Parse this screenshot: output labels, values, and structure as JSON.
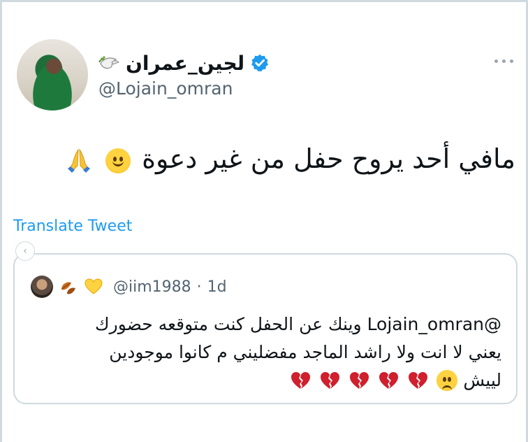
{
  "author": {
    "display_name": "لجين_عمران",
    "handle": "@Lojain_omran",
    "verified": true,
    "name_emoji": "dove-icon"
  },
  "tweet": {
    "text": "مافي أحد يروح حفل من غير دعوة",
    "emojis": [
      "smiling-face-icon",
      "folded-hands-icon"
    ],
    "translate_label": "Translate Tweet"
  },
  "quoted": {
    "handle": "@iim1988",
    "separator": "·",
    "time": "1d",
    "name_emojis": [
      "fallen-leaves-icon",
      "yellow-heart-icon"
    ],
    "line1": "@Lojain_omran وينك عن الحفل كنت متوقعه حضورك",
    "line2": "يعني لا انت ولا راشد الماجد مفضليني م كانوا موجودين",
    "line3": "لييش",
    "line3_emojis": [
      "frowning-face-icon",
      "broken-heart-icon",
      "broken-heart-icon",
      "broken-heart-icon",
      "broken-heart-icon",
      "broken-heart-icon"
    ]
  },
  "colors": {
    "link": "#1d9bf0",
    "secondary_text": "#536471",
    "verified": "#1d9bf0",
    "border": "#cfd9de",
    "broken_heart": "#d01f2d"
  }
}
